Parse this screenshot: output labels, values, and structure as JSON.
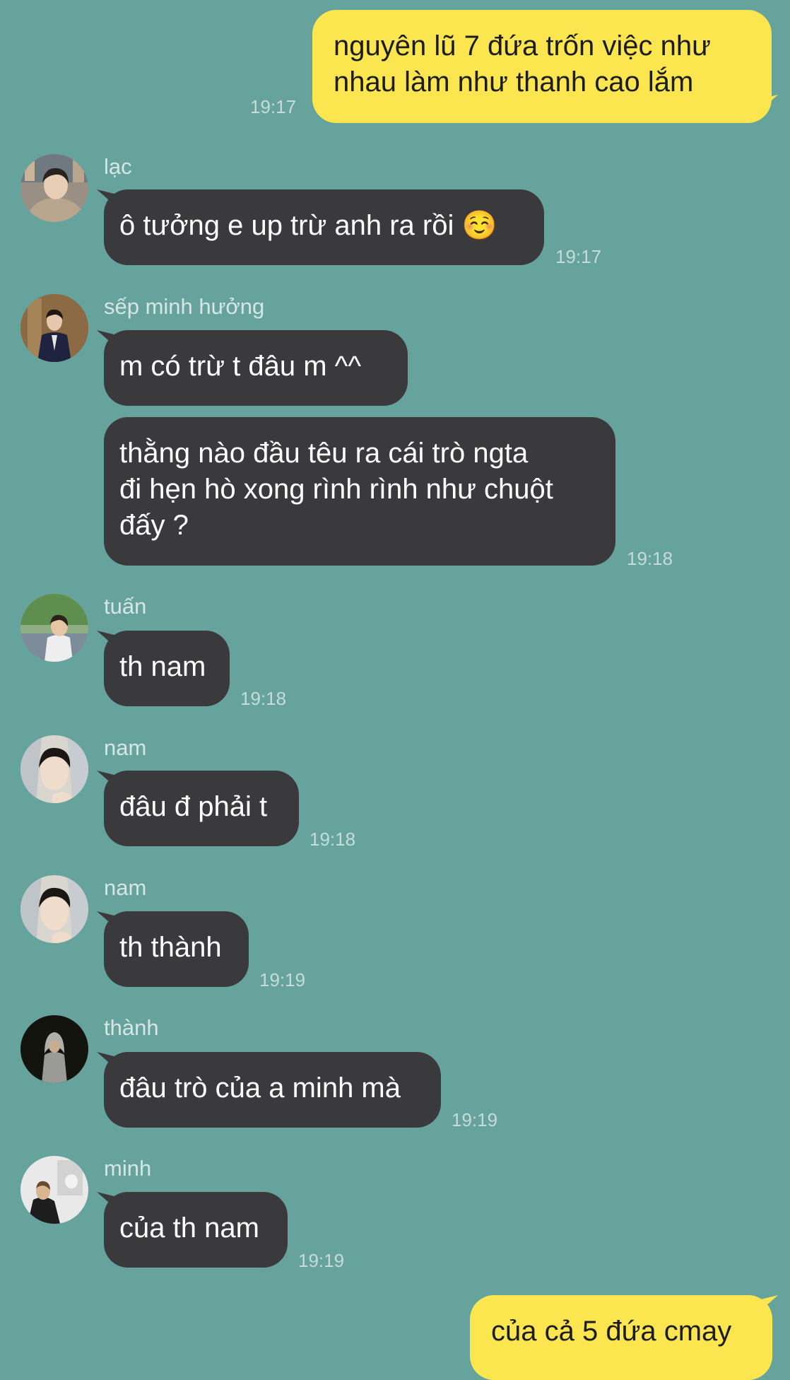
{
  "colors": {
    "background": "#67a39d",
    "incoming_bubble": "#3a3a3c",
    "outgoing_bubble": "#fbe64f",
    "timestamp": "#c5dcd9",
    "sender_name": "#d5e6e4"
  },
  "messages": [
    {
      "direction": "out",
      "text": "nguyên lũ 7 đứa trốn việc như\nnhau làm như thanh cao lắm",
      "time": "19:17"
    },
    {
      "direction": "in",
      "sender": "lạc",
      "avatar": "avatar-lac",
      "text": "ô tưởng e up trừ anh ra rồi ☺️",
      "time": "19:17"
    },
    {
      "direction": "in",
      "sender": "sếp minh hưởng",
      "avatar": "avatar-sep-minh-huong",
      "text": "m có trừ t đâu m ^^",
      "time": ""
    },
    {
      "direction": "in",
      "sender": "",
      "avatar": "",
      "text": "thằng nào đầu têu ra cái trò ngta\nđi hẹn hò xong rình rình như chuột\nđấy ?",
      "time": "19:18"
    },
    {
      "direction": "in",
      "sender": "tuấn",
      "avatar": "avatar-tuan",
      "text": "th nam",
      "time": "19:18"
    },
    {
      "direction": "in",
      "sender": "nam",
      "avatar": "avatar-nam",
      "text": "đâu đ phải t",
      "time": "19:18"
    },
    {
      "direction": "in",
      "sender": "nam",
      "avatar": "avatar-nam",
      "text": "th thành",
      "time": "19:19"
    },
    {
      "direction": "in",
      "sender": "thành",
      "avatar": "avatar-thanh",
      "text": "đâu trò của a minh mà",
      "time": "19:19"
    },
    {
      "direction": "in",
      "sender": "minh",
      "avatar": "avatar-minh",
      "text": "của th nam",
      "time": "19:19"
    },
    {
      "direction": "out",
      "text": "của cả 5 đứa cmay",
      "time": ""
    }
  ]
}
